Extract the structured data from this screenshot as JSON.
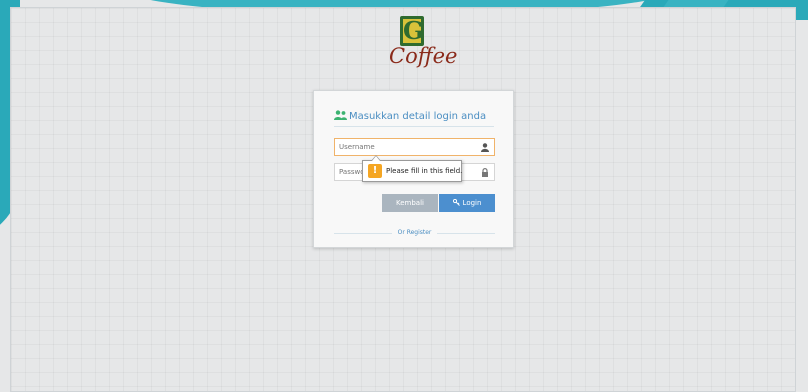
{
  "brand": {
    "logo_letter": "G",
    "name": "Coffee"
  },
  "login": {
    "header": "Masukkan detail login anda",
    "username_placeholder": "Username",
    "password_placeholder": "Password",
    "validation_message": "Please fill in this field.",
    "back_button": "Kembali",
    "login_button": "Login",
    "register_link": "Or Register"
  },
  "icons": {
    "header": "users-icon",
    "username": "user-icon",
    "password": "lock-icon",
    "login": "key-icon",
    "validation": "warning-icon"
  },
  "colors": {
    "accent": "#4c8fcf",
    "header_text": "#4b8ec2",
    "back_button": "#aab5bf",
    "focus_border": "#f0b36a",
    "warning": "#f5a623",
    "decor_teal": "#2aa9b9",
    "logo_green": "#2f6b2f",
    "logo_yellow": "#d8c23a",
    "logo_text": "#8a2a1a"
  }
}
